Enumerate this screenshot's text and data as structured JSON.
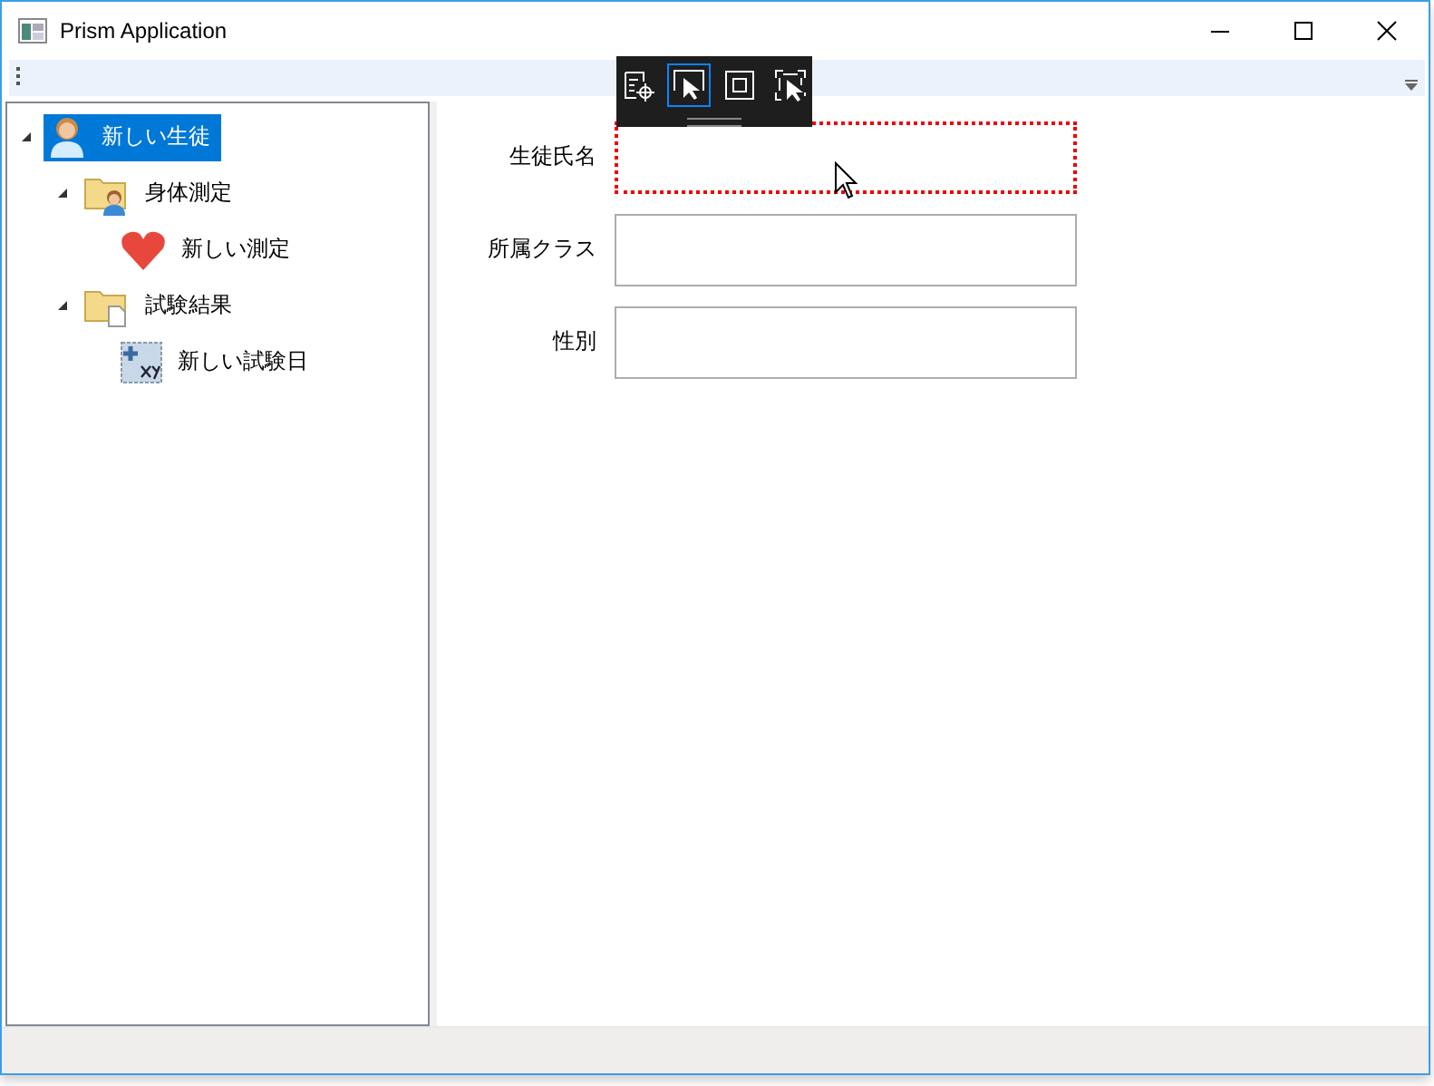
{
  "window": {
    "title": "Prism Application"
  },
  "debug_toolbar": {
    "tools": [
      {
        "kind": "properties",
        "selected": false
      },
      {
        "kind": "select",
        "selected": true
      },
      {
        "kind": "layout",
        "selected": false
      },
      {
        "kind": "preview",
        "selected": false
      }
    ]
  },
  "tree": [
    {
      "label": "新しい生徒",
      "kind": "person",
      "selected": true,
      "expanded": true,
      "children": [
        {
          "label": "身体測定",
          "kind": "folder-person",
          "selected": false,
          "expanded": true,
          "children": [
            {
              "label": "新しい測定",
              "kind": "heart",
              "selected": false
            }
          ]
        },
        {
          "label": "試験結果",
          "kind": "folder-doc",
          "selected": false,
          "expanded": true,
          "children": [
            {
              "label": "新しい試験日",
              "kind": "xy",
              "selected": false
            }
          ]
        }
      ]
    }
  ],
  "form": [
    {
      "label": "生徒氏名",
      "highlighted": true
    },
    {
      "label": "所属クラス",
      "highlighted": false
    },
    {
      "label": "性別",
      "highlighted": false
    }
  ]
}
